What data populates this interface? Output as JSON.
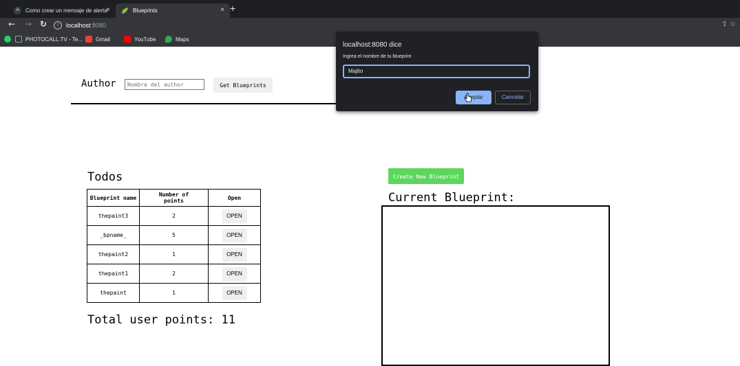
{
  "browser": {
    "tabs": [
      {
        "label": "Como crear un mensaje de alerta",
        "icon": "A"
      },
      {
        "label": "Blueprints",
        "icon": "leaf-icon"
      }
    ],
    "tab_close": "×",
    "new_tab": "+",
    "url_host": "localhost",
    "url_port": ":8080",
    "bookmarks": [
      {
        "label": "PHOTOCALL.TV - Te..."
      },
      {
        "label": "Gmail"
      },
      {
        "label": "YouTube"
      },
      {
        "label": "Maps"
      }
    ]
  },
  "page": {
    "author_label": "Author",
    "author_placeholder": "Nombre del author",
    "get_button": "Get Blueprints",
    "todos_title": "Todos",
    "table": {
      "headers": [
        "Blueprint name",
        "Number of points",
        "Open"
      ],
      "rows": [
        {
          "name": "thepaint3",
          "points": "2",
          "action": "OPEN"
        },
        {
          "name": "_bpname_",
          "points": "5",
          "action": "OPEN"
        },
        {
          "name": "thepaint2",
          "points": "1",
          "action": "OPEN"
        },
        {
          "name": "thepaint1",
          "points": "2",
          "action": "OPEN"
        },
        {
          "name": "thepaint",
          "points": "1",
          "action": "OPEN"
        }
      ]
    },
    "total_label": "Total user points: 11",
    "create_button": "Create New Blueprint",
    "current_label": "Current Blueprint:"
  },
  "dialog": {
    "title": "localhost:8080 dice",
    "message": "Ingrea el nombre de tu blueprint",
    "input_value": "Majito",
    "ok_label": "Aceptar",
    "cancel_label": "Cancelar"
  },
  "colors": {
    "create_button": "#5cd65c",
    "dialog_accent": "#8ab4f8"
  }
}
